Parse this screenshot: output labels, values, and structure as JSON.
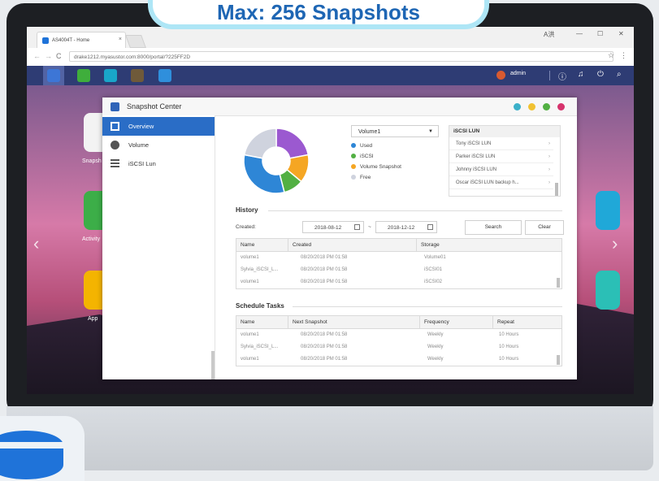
{
  "banner": {
    "text": "Max: 256 Snapshots"
  },
  "browser": {
    "tab_title": "AS4004T - Home",
    "tab_close": "×",
    "window_controls": [
      "A洪",
      "—",
      "☐",
      "✕"
    ],
    "url": "drake1212.myasustor.com:8000/portal/?225FF2D",
    "back": "←",
    "forward": "→",
    "reload": "C"
  },
  "taskbar": {
    "user": "admin"
  },
  "desktop": {
    "labels": [
      "Snapsh",
      "Activity",
      "App"
    ]
  },
  "window": {
    "title": "Snapshot Center",
    "dot_colors": [
      "#3bb0c9",
      "#f1c232",
      "#52b043",
      "#d6336c"
    ]
  },
  "sidebar": {
    "items": [
      {
        "label": "Overview"
      },
      {
        "label": "Volume"
      },
      {
        "label": "iSCSI Lun"
      }
    ]
  },
  "overview": {
    "volume_select": "Volume1",
    "legend": [
      {
        "label": "Used",
        "color": "#2e86d6"
      },
      {
        "label": "iSCSI",
        "color": "#52b043"
      },
      {
        "label": "Volume Snapshot",
        "color": "#f5a623"
      },
      {
        "label": "Free",
        "color": "#cfd3de"
      }
    ],
    "donut_segments": [
      {
        "color": "#9b59d0",
        "value": 22
      },
      {
        "color": "#f5a623",
        "value": 14
      },
      {
        "color": "#52b043",
        "value": 10
      },
      {
        "color": "#2e86d6",
        "value": 32
      },
      {
        "color": "#cfd3de",
        "value": 22
      }
    ],
    "iscsi_lun": {
      "header": "iSCSI LUN",
      "items": [
        "Tony iSCSI LUN",
        "Parker iSCSI LUN",
        "Johnny iSCSI LUN",
        "Oscar iSCSI LUN backup h..."
      ],
      "chevron": "›"
    }
  },
  "history": {
    "title": "History",
    "created_label": "Created:",
    "from": "2018-08-12",
    "tilde": "~",
    "to": "2018-12-12",
    "search": "Search",
    "clear": "Clear",
    "columns": [
      "Name",
      "Created",
      "Storage"
    ],
    "rows": [
      [
        "volume1",
        "08/20/2018 PM 01:58",
        "Volume01"
      ],
      [
        "Sylvia_iSCSI_L...",
        "08/20/2018 PM 01:58",
        "iSCSI01"
      ],
      [
        "volume1",
        "08/20/2018 PM 01:58",
        "iSCSI02"
      ]
    ]
  },
  "schedule": {
    "title": "Schedule Tasks",
    "columns": [
      "Name",
      "Next Snapshot",
      "Frequency",
      "Repeat"
    ],
    "rows": [
      [
        "volume1",
        "08/20/2018 PM 01:58",
        "Weekly",
        "10 Hours"
      ],
      [
        "Sylvia_iSCSI_L...",
        "08/20/2018 PM 01:58",
        "Weekly",
        "10 Hours"
      ],
      [
        "volume1",
        "08/20/2018 PM 01:58",
        "Weekly",
        "10 Hours"
      ]
    ]
  }
}
